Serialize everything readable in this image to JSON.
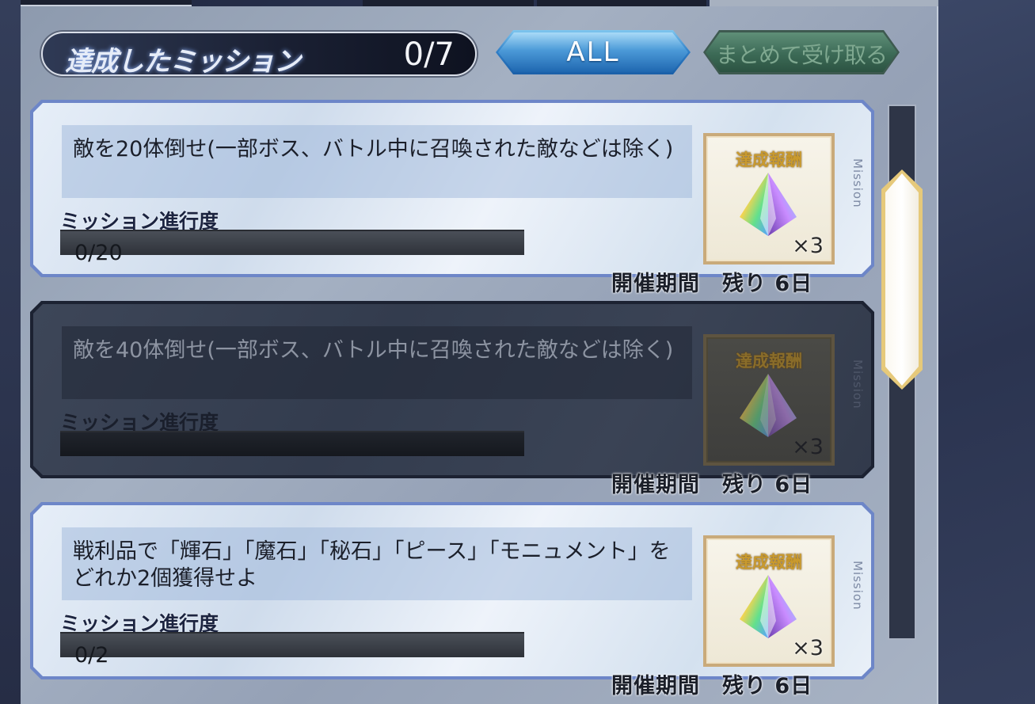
{
  "header": {
    "title": "達成したミッション",
    "count": "0/7",
    "filter_label": "ALL",
    "collect_all_label": "まとめて受け取る"
  },
  "missions": [
    {
      "description": "敵を20体倒せ(一部ボス、バトル中に召喚された敵などは除く)",
      "progress_label": "ミッション進行度",
      "progress_text": "0/20",
      "progress_fraction": 0,
      "side_tag": "Mission",
      "reward_title": "達成報酬",
      "reward_icon": "saint-quartz-icon",
      "reward_quantity": "×3",
      "period": "開催期間　残り 6日",
      "locked": false
    },
    {
      "description": "敵を40体倒せ(一部ボス、バトル中に召喚された敵などは除く)",
      "progress_label": "ミッション進行度",
      "progress_text": "",
      "progress_fraction": 0,
      "side_tag": "Mission",
      "reward_title": "達成報酬",
      "reward_icon": "saint-quartz-icon",
      "reward_quantity": "×3",
      "period": "開催期間　残り 6日",
      "locked": true
    },
    {
      "description": "戦利品で「輝石」「魔石」「秘石」「ピース」「モニュメント」をどれか2個獲得せよ",
      "progress_label": "ミッション進行度",
      "progress_text": "0/2",
      "progress_fraction": 0,
      "side_tag": "Mission",
      "reward_title": "達成報酬",
      "reward_icon": "saint-quartz-icon",
      "reward_quantity": "×3",
      "period": "開催期間　残り 6日",
      "locked": false
    }
  ],
  "colors": {
    "accent_blue": "#2e7dc6",
    "collect_green": "#3c6a56",
    "reward_gold": "#c99a2e",
    "scroll_thumb": "#e6c97a"
  }
}
